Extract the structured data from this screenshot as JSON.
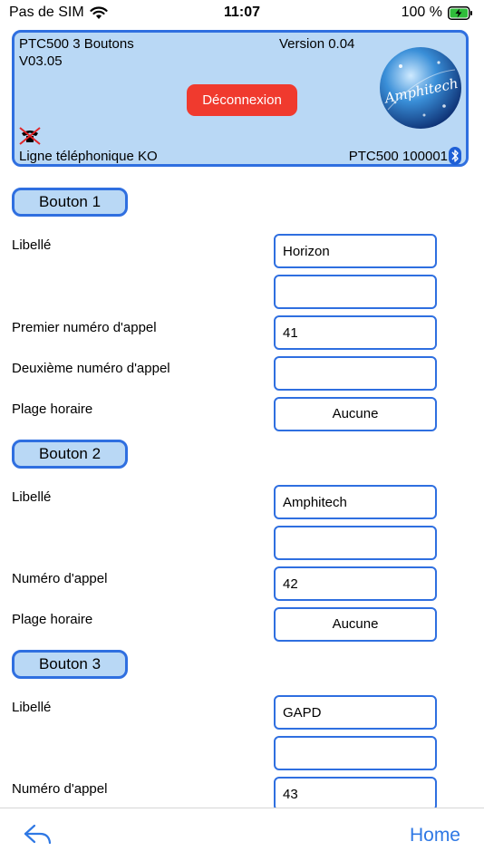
{
  "status_bar": {
    "carrier": "Pas de SIM",
    "time": "11:07",
    "battery": "100 %"
  },
  "header": {
    "device": "PTC500 3 Boutons",
    "version": "Version 0.04",
    "firmware": "V03.05",
    "disconnect_label": "Déconnexion",
    "logo_text": "Amphitech",
    "line_status": "Ligne téléphonique KO",
    "serial": "PTC500 100001"
  },
  "sections": [
    {
      "title": "Bouton 1",
      "label_libelle": "Libellé",
      "libelle_1": "Horizon",
      "libelle_2": "",
      "label_num1": "Premier numéro d'appel",
      "num1": "41",
      "label_num2": "Deuxième numéro d'appel",
      "num2": "",
      "label_plage": "Plage horaire",
      "plage": "Aucune"
    },
    {
      "title": "Bouton 2",
      "label_libelle": "Libellé",
      "libelle_1": "Amphitech",
      "libelle_2": "",
      "label_num": "Numéro d'appel",
      "num": "42",
      "label_plage": "Plage horaire",
      "plage": "Aucune"
    },
    {
      "title": "Bouton 3",
      "label_libelle": "Libellé",
      "libelle_1": "GAPD",
      "libelle_2": "",
      "label_num": "Numéro d'appel",
      "num": "43"
    }
  ],
  "bottom_bar": {
    "back_icon": "back-arrow-icon",
    "home_label": "Home"
  },
  "colors": {
    "accent": "#2f6fe0",
    "header_bg": "#b9d8f5",
    "danger": "#f03a2e",
    "link": "#2f78e4"
  }
}
